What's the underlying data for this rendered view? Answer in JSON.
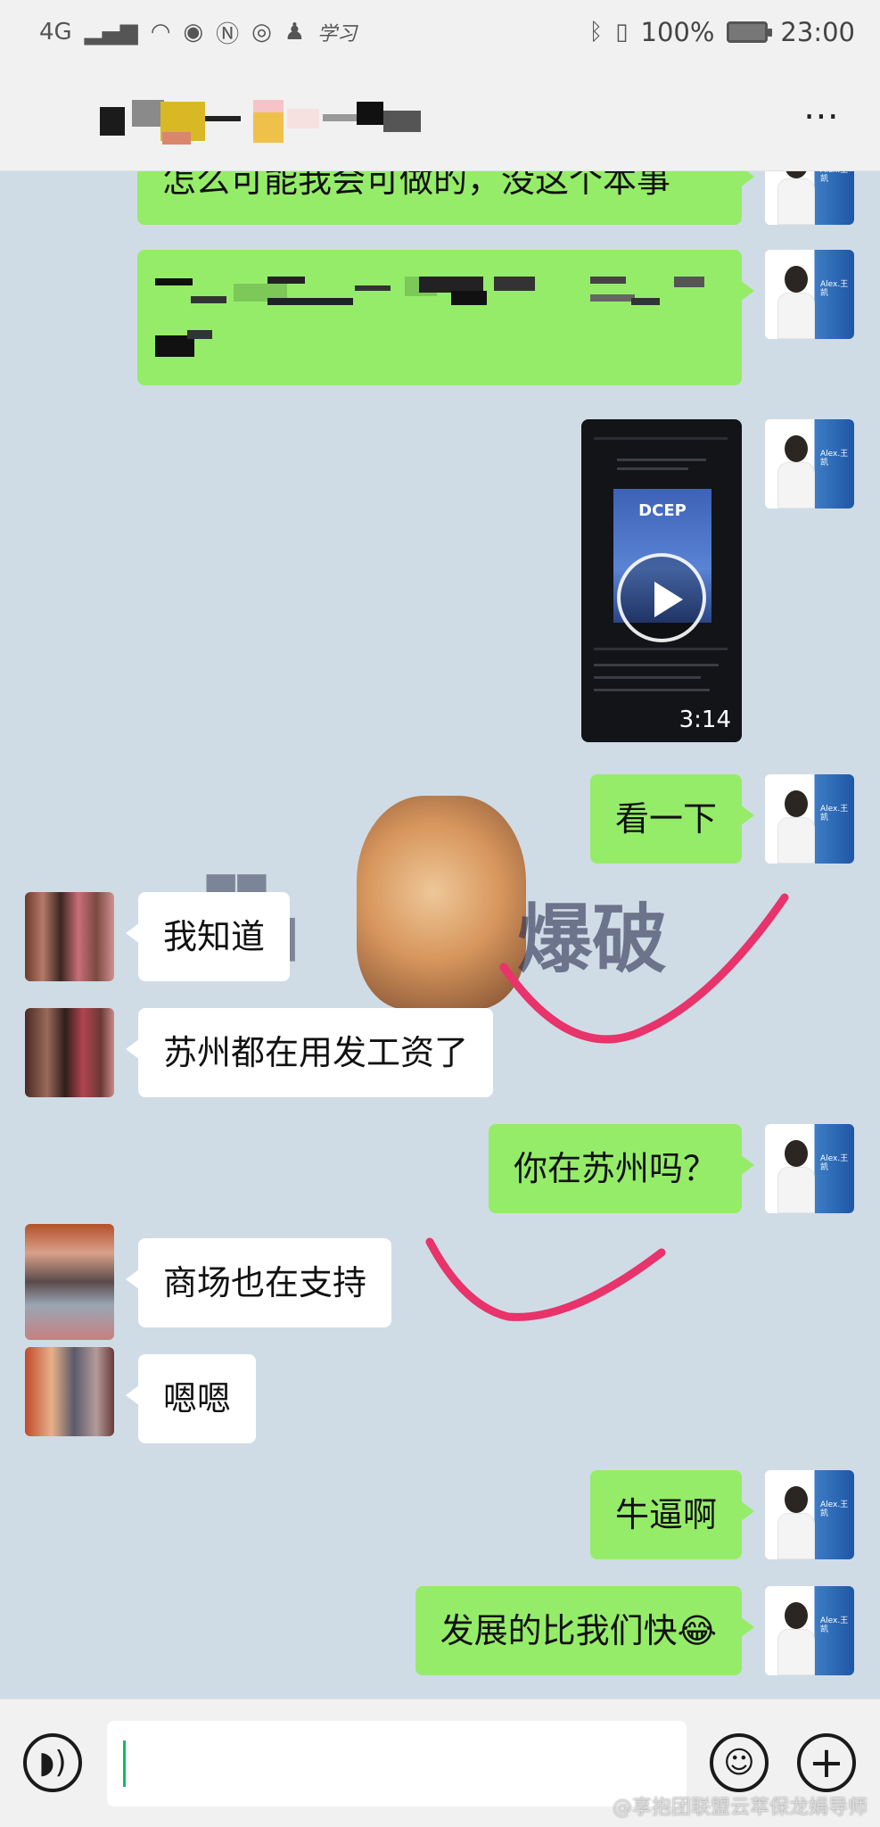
{
  "status_bar": {
    "network": "4G",
    "extra_label": "学习",
    "battery": "100%",
    "time": "23:00"
  },
  "header": {
    "more_icon": "⋯"
  },
  "messages": [
    {
      "side": "me",
      "type": "text",
      "text": "怎么可能我会可做的，没这个本事"
    },
    {
      "side": "me",
      "type": "redacted"
    },
    {
      "side": "me",
      "type": "video",
      "title": "DCEP",
      "duration": "3:14"
    },
    {
      "side": "me",
      "type": "text",
      "text": "看一下"
    },
    {
      "side": "other",
      "type": "text",
      "text": "我知道"
    },
    {
      "side": "other",
      "type": "text",
      "text": "苏州都在用发工资了"
    },
    {
      "side": "me",
      "type": "text",
      "text": "你在苏州吗？"
    },
    {
      "side": "other",
      "type": "text",
      "text": "商场也在支持"
    },
    {
      "side": "other",
      "type": "text",
      "text": "嗯嗯"
    },
    {
      "side": "me",
      "type": "text",
      "text": "牛逼啊"
    },
    {
      "side": "me",
      "type": "text",
      "text": "发展的比我们快😂"
    }
  ],
  "overlay": {
    "banner_text": "爆破"
  },
  "input_bar": {
    "voice_icon": "voice-icon",
    "emoji_icon": "emoji-icon",
    "plus_icon": "plus-icon"
  },
  "credit": "@享抱团联盟云萃保龙娟导师"
}
